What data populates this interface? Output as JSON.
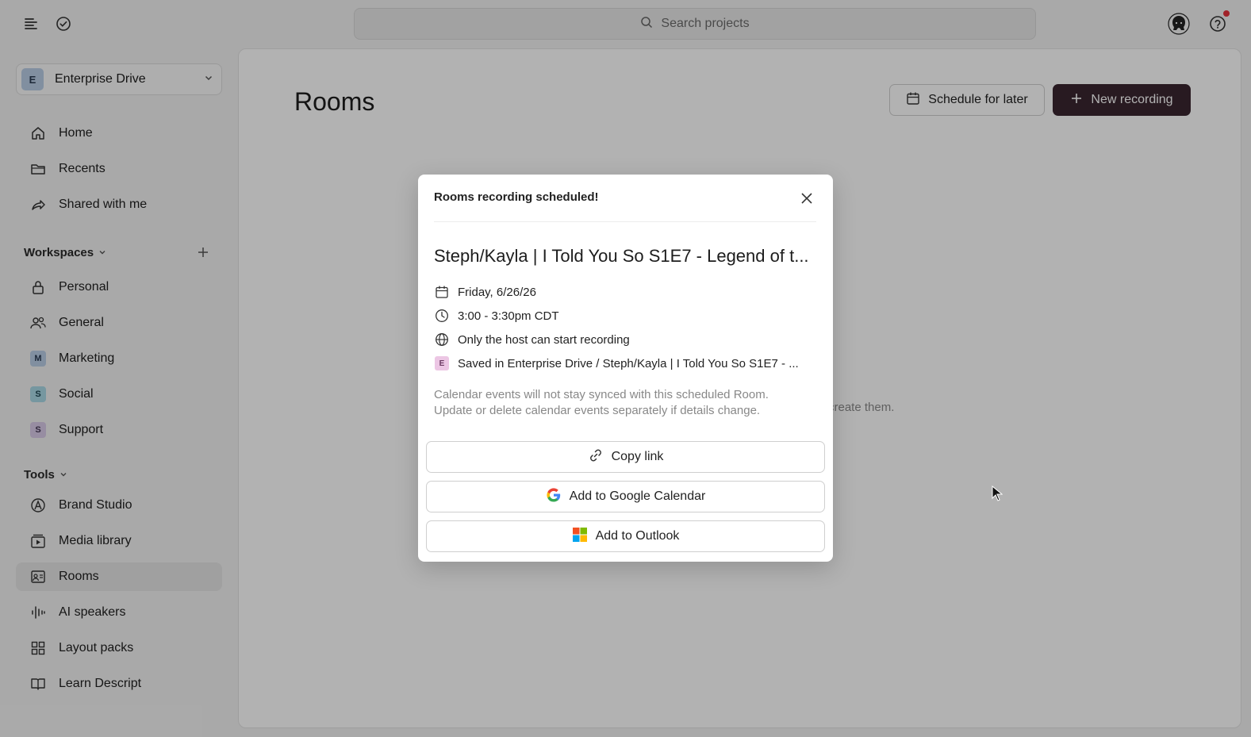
{
  "topbar": {
    "search_placeholder": "Search projects"
  },
  "sidebar": {
    "drive": {
      "badge": "E",
      "label": "Enterprise Drive"
    },
    "nav": [
      {
        "label": "Home",
        "icon": "home-icon"
      },
      {
        "label": "Recents",
        "icon": "folder-icon"
      },
      {
        "label": "Shared with me",
        "icon": "share-icon"
      }
    ],
    "workspaces_label": "Workspaces",
    "workspaces": [
      {
        "label": "Personal",
        "icon": "lock-icon"
      },
      {
        "label": "General",
        "icon": "people-icon"
      },
      {
        "label": "Marketing",
        "badge": "M",
        "badge_color": "#b9cde6"
      },
      {
        "label": "Social",
        "badge": "S",
        "badge_color": "#a9d8e6"
      },
      {
        "label": "Support",
        "badge": "S",
        "badge_color": "#d9cbe8"
      }
    ],
    "tools_label": "Tools",
    "tools": [
      {
        "label": "Brand Studio",
        "icon": "brand-icon"
      },
      {
        "label": "Media library",
        "icon": "media-icon"
      },
      {
        "label": "Rooms",
        "icon": "rooms-icon",
        "active": true
      },
      {
        "label": "AI speakers",
        "icon": "waveform-icon"
      },
      {
        "label": "Layout packs",
        "icon": "grid-icon"
      },
      {
        "label": "Learn Descript",
        "icon": "book-icon"
      }
    ]
  },
  "main": {
    "title": "Rooms",
    "schedule_label": "Schedule for later",
    "new_recording_label": "New recording",
    "empty_hint_fragment": "create them."
  },
  "modal": {
    "title": "Rooms recording scheduled!",
    "event_name": "Steph/Kayla | I Told You So S1E7 - Legend of t...",
    "date": "Friday, 6/26/26",
    "time": "3:00 - 3:30pm CDT",
    "permission": "Only the host can start recording",
    "saved_badge": "E",
    "saved_in": "Saved in Enterprise Drive / Steph/Kayla | I Told You So S1E7 - ...",
    "note_line1": "Calendar events will not stay synced with this scheduled Room.",
    "note_line2": "Update or delete calendar events separately if details change.",
    "copy_link": "Copy link",
    "google_calendar": "Add to Google Calendar",
    "outlook": "Add to Outlook"
  },
  "colors": {
    "primary_button": "#3a2630",
    "overlay": "rgba(0,0,0,0.30)",
    "notification_dot": "#e5323b"
  }
}
